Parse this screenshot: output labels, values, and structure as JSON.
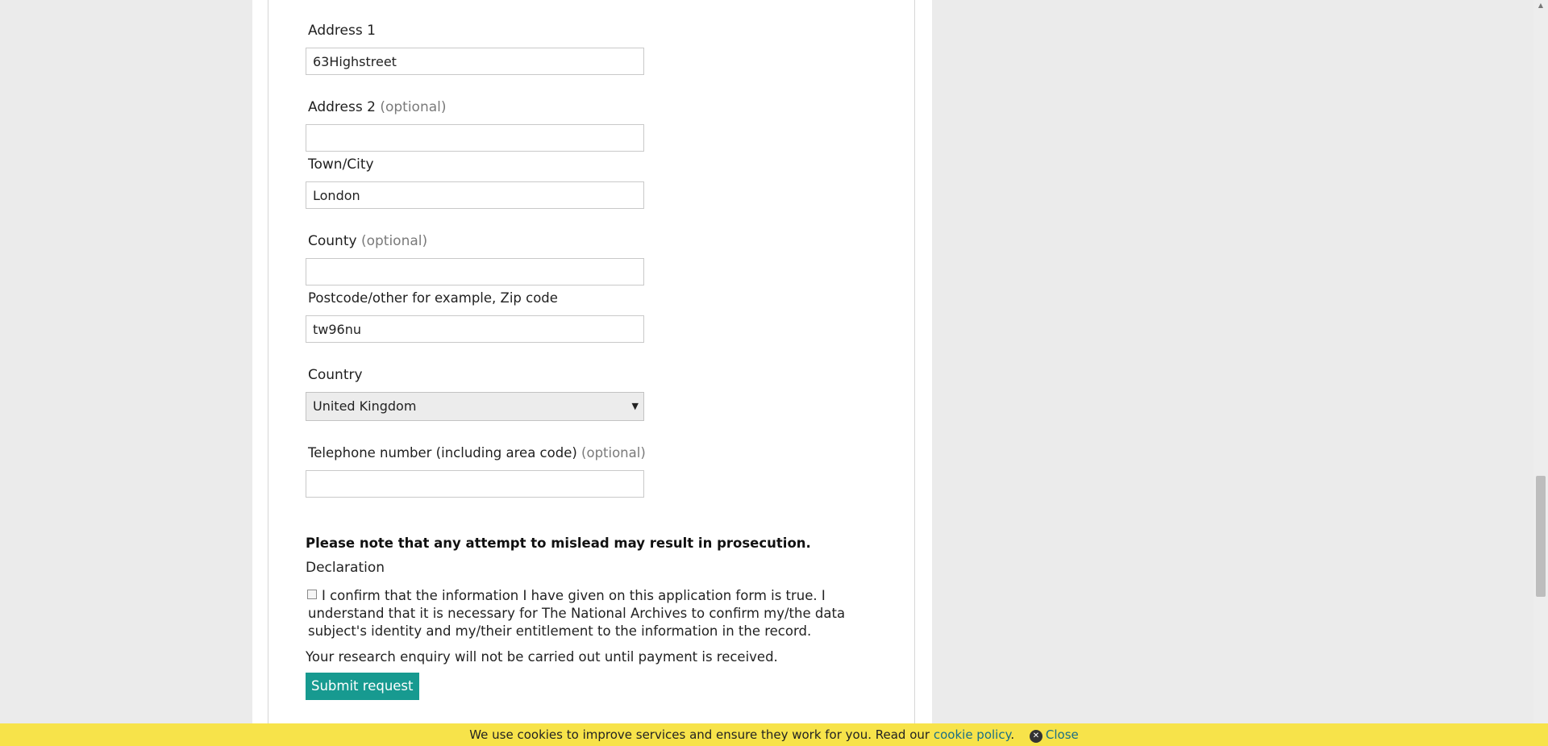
{
  "form": {
    "address1": {
      "label": "Address 1",
      "value": "63Highstreet"
    },
    "address2": {
      "label": "Address 2",
      "optional": "(optional)",
      "value": ""
    },
    "town": {
      "label": "Town/City",
      "value": "London"
    },
    "county": {
      "label": "County",
      "optional": "(optional)",
      "value": ""
    },
    "postcode": {
      "label": "Postcode/other for example, Zip code",
      "value": "tw96nu"
    },
    "country": {
      "label": "Country",
      "value": "United Kingdom"
    },
    "telephone": {
      "label": "Telephone number (including area code)",
      "optional": "(optional)",
      "value": ""
    }
  },
  "warning": "Please note that any attempt to mislead may result in prosecution.",
  "declaration": {
    "heading": "Declaration",
    "text": "I confirm that the information I have given on this application form is true. I understand that it is necessary for The National Archives to confirm my/the data subject's identity and my/their entitlement to the information in the record.",
    "checked": false
  },
  "payment_note": "Your research enquiry will not be carried out until payment is received.",
  "submit_label": "Submit request",
  "cookie": {
    "text": "We use cookies to improve services and ensure they work for you. Read our",
    "link": "cookie policy",
    "period": ".",
    "close": "Close"
  },
  "colors": {
    "accent": "#179a90",
    "cookie_bar": "#f7e34a",
    "link": "#1b6f86"
  }
}
